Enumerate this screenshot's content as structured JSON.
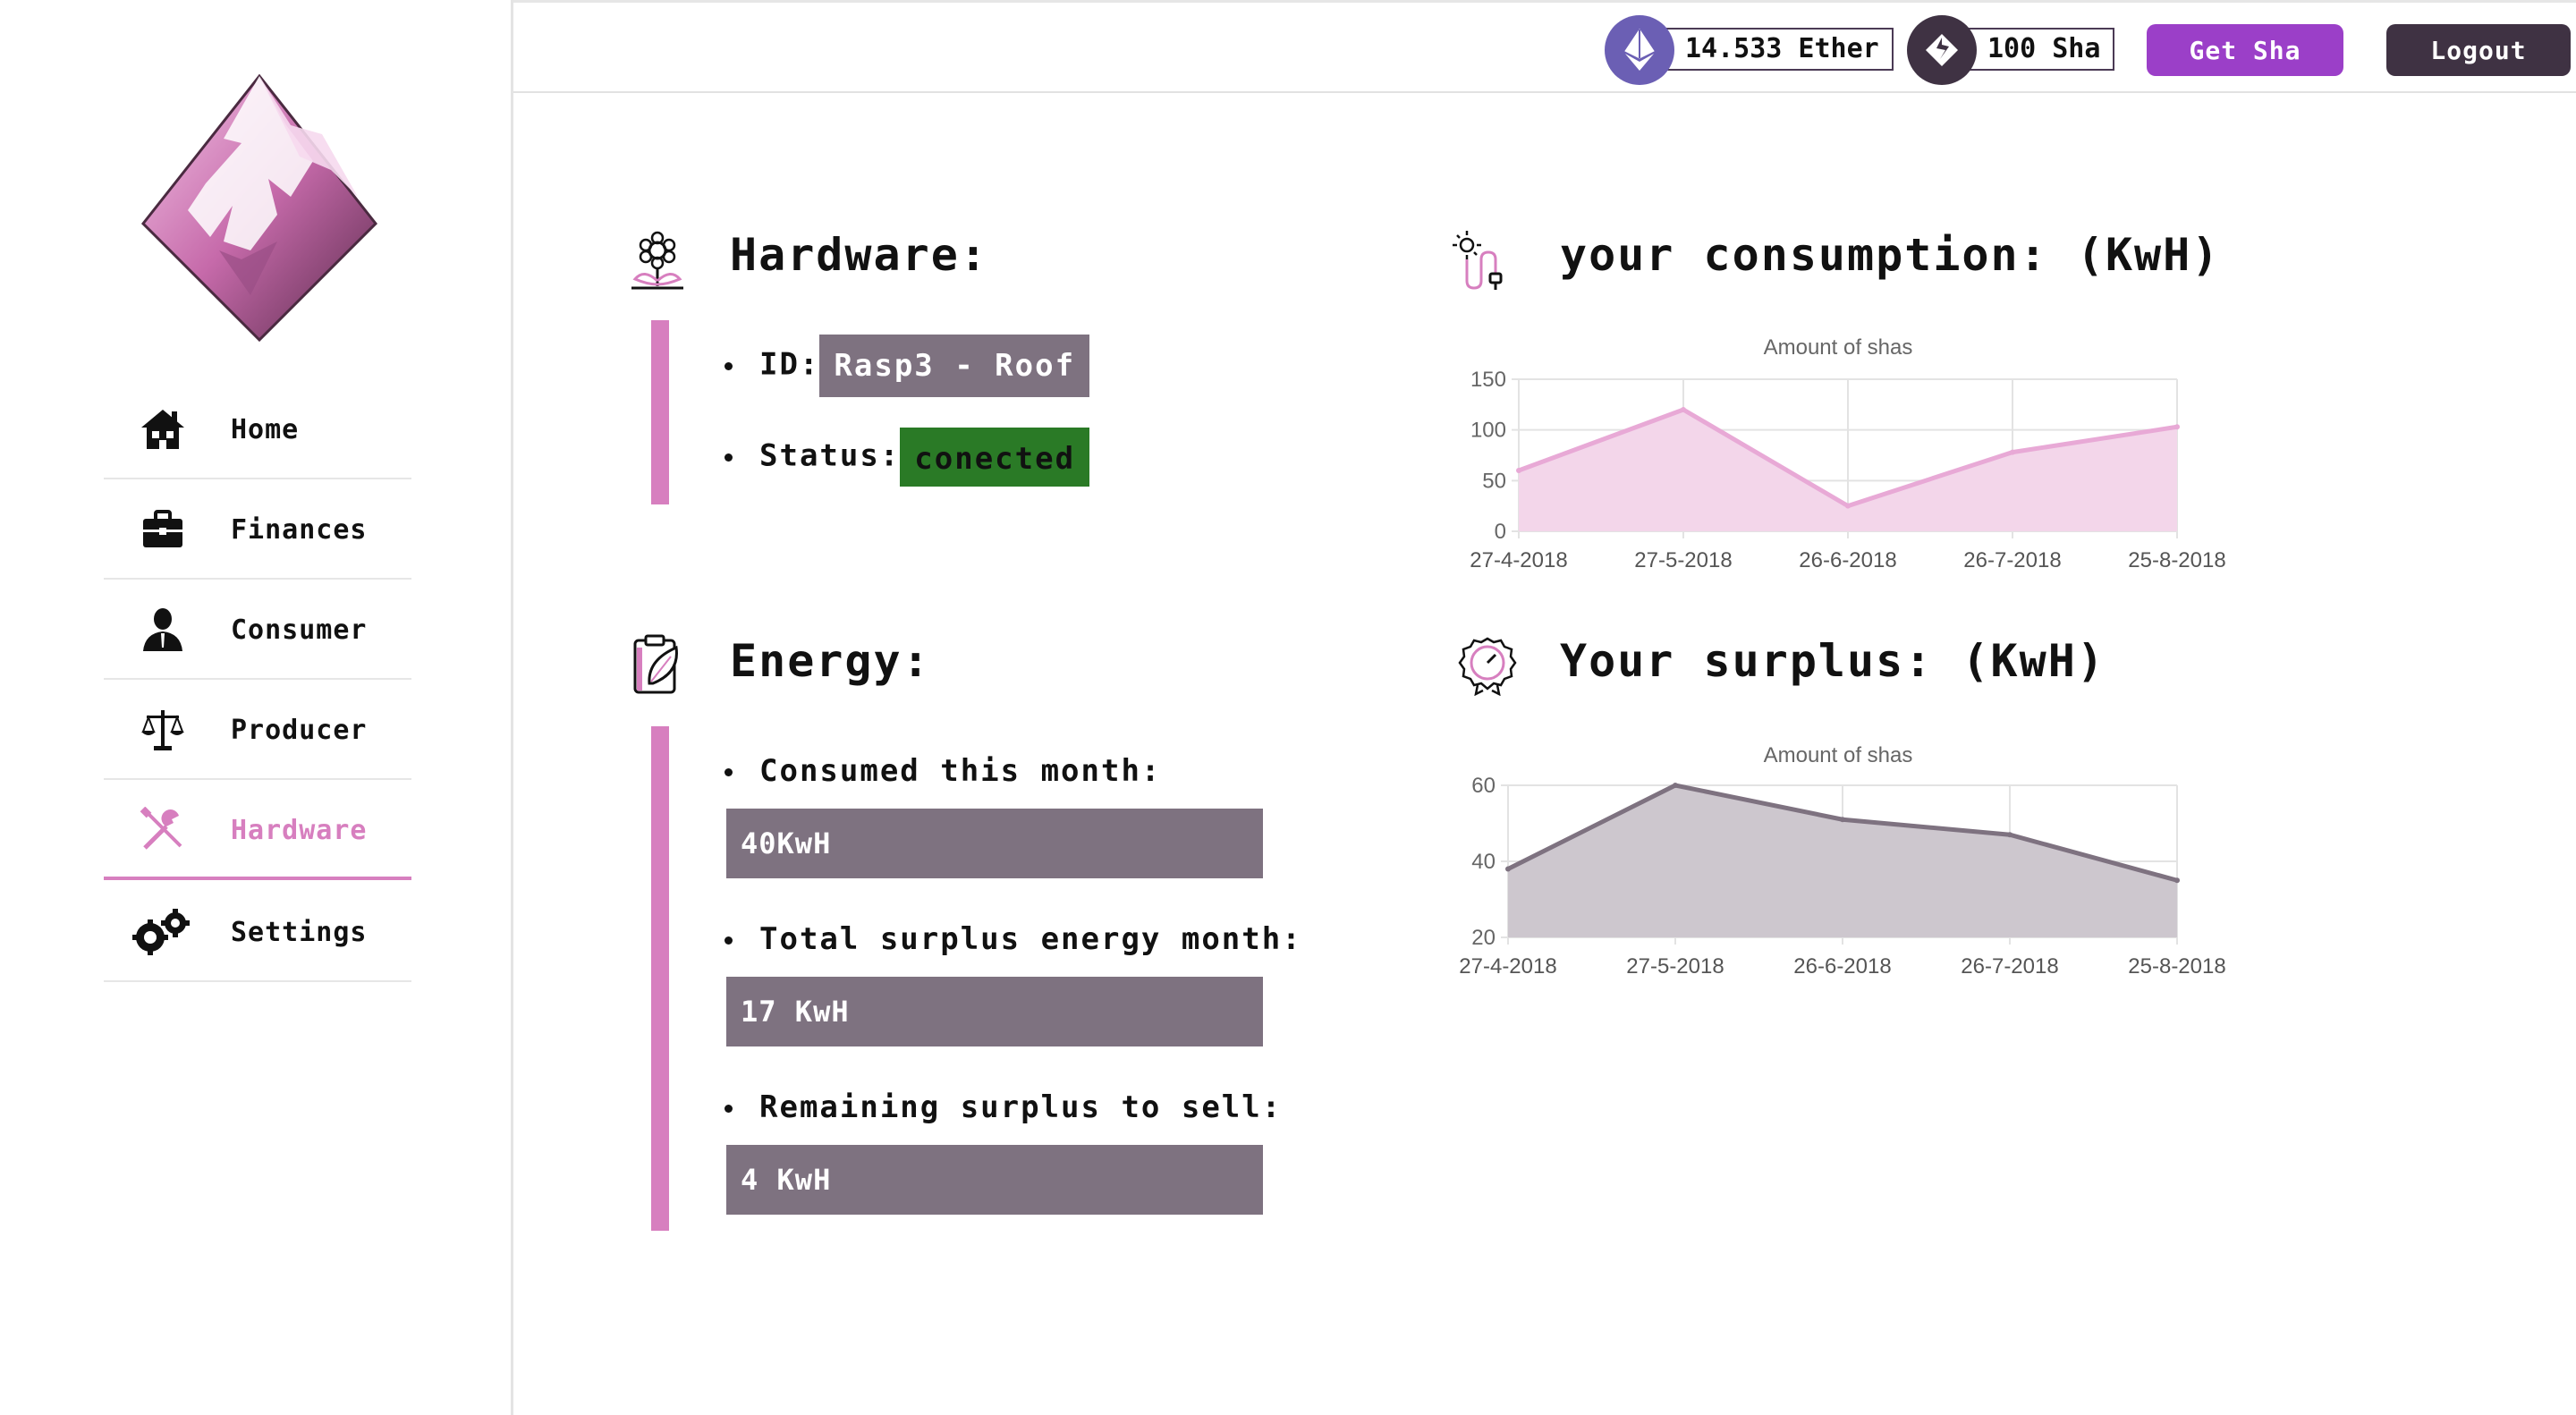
{
  "sidebar": {
    "items": [
      {
        "label": "Home",
        "icon": "house-icon"
      },
      {
        "label": "Finances",
        "icon": "briefcase-icon"
      },
      {
        "label": "Consumer",
        "icon": "person-icon"
      },
      {
        "label": "Producer",
        "icon": "scale-icon"
      },
      {
        "label": "Hardware",
        "icon": "tools-icon",
        "active": true
      },
      {
        "label": "Settings",
        "icon": "gears-icon"
      }
    ]
  },
  "topbar": {
    "ether_balance": "14.533 Ether",
    "sha_balance": "100 Sha",
    "get_sha_label": "Get Sha",
    "logout_label": "Logout"
  },
  "hardware": {
    "title": "Hardware:",
    "id_label": "ID:",
    "id_value": "Rasp3 - Roof",
    "status_label": "Status:",
    "status_value": "conected"
  },
  "energy": {
    "title": "Energy:",
    "consumed_label": "Consumed this month:",
    "consumed_value": "40KwH",
    "surplus_label": "Total surplus energy month:",
    "surplus_value": "17 KwH",
    "remaining_label": "Remaining surplus to sell:",
    "remaining_value": "4 KwH"
  },
  "consumption_section": {
    "title": "your consumption: (KwH)"
  },
  "surplus_section": {
    "title": "Your surplus: (KwH)"
  },
  "colors": {
    "accent_pink": "#d77fbf",
    "purple_button": "#9b3fc8",
    "dark_button": "#3f3243",
    "value_box": "#7e7280",
    "status_green": "#2a7a26"
  },
  "chart_data": [
    {
      "type": "area",
      "title": "Amount of shas",
      "x": [
        "27-4-2018",
        "27-5-2018",
        "26-6-2018",
        "26-7-2018",
        "25-8-2018"
      ],
      "values": [
        60,
        120,
        25,
        78,
        103
      ],
      "ylim": [
        0,
        150
      ],
      "yticks": [
        0,
        50,
        100,
        150
      ],
      "grid": true,
      "line_color": "#e8a9d6",
      "fill_color": "#f3d6ea"
    },
    {
      "type": "area",
      "title": "Amount of shas",
      "x": [
        "27-4-2018",
        "27-5-2018",
        "26-6-2018",
        "26-7-2018",
        "25-8-2018"
      ],
      "values": [
        38,
        60,
        51,
        47,
        35
      ],
      "ylim": [
        20,
        60
      ],
      "yticks": [
        20,
        40,
        60
      ],
      "grid": true,
      "line_color": "#7e7280",
      "fill_color": "#cdc7ce"
    }
  ]
}
